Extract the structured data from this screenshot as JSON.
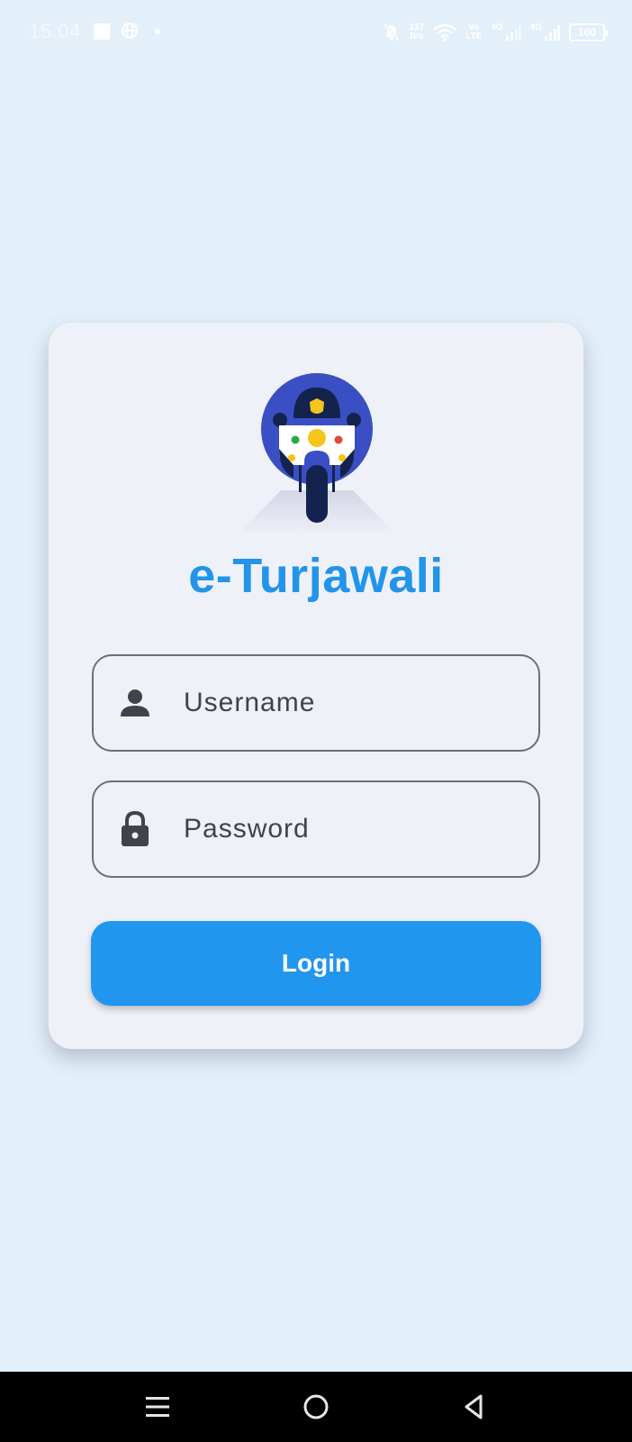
{
  "status_bar": {
    "time": "15.04",
    "net_speed_top": "137",
    "net_speed_bottom": "B/s",
    "volte_top": "Vo",
    "volte_bottom": "LTE",
    "sim1_type": "4G",
    "sim2_type": "4G",
    "battery": "100",
    "icons": [
      "stop-square-icon",
      "globe-icon",
      "dot-icon",
      "bell-off-icon",
      "wifi-icon",
      "signal-icon",
      "signal-icon",
      "battery-icon"
    ]
  },
  "app": {
    "title": "e-Turjawali",
    "logo": "police-motorcycle-logo"
  },
  "form": {
    "username_placeholder": "Username",
    "username_value": "",
    "username_icon": "person-icon",
    "password_placeholder": "Password",
    "password_value": "",
    "password_icon": "lock-icon",
    "login_label": "Login"
  },
  "nav_bar": {
    "icons": [
      "menu-icon",
      "home-circle-icon",
      "back-triangle-icon"
    ]
  },
  "colors": {
    "background": "#e3eff9",
    "card": "#eff1f9",
    "accent": "#2196ef",
    "title": "#2294ea",
    "logo_circle": "#3a4fc3",
    "logo_dark": "#13234e"
  }
}
